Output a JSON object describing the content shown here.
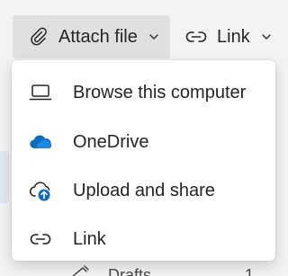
{
  "toolbar": {
    "attach_label": "Attach file",
    "link_label": "Link"
  },
  "menu": {
    "items": [
      {
        "label": "Browse this computer",
        "icon": "laptop-icon"
      },
      {
        "label": "OneDrive",
        "icon": "onedrive-cloud-icon"
      },
      {
        "label": "Upload and share",
        "icon": "cloud-upload-icon"
      },
      {
        "label": "Link",
        "icon": "link-icon"
      }
    ]
  },
  "background": {
    "folder_label": "Drafts",
    "folder_count": "1"
  },
  "colors": {
    "attach_button_bg": "#e0e0e0",
    "onedrive_blue": "#0f6cbd",
    "menu_bg": "#ffffff",
    "page_bg": "#f3f3f3"
  }
}
